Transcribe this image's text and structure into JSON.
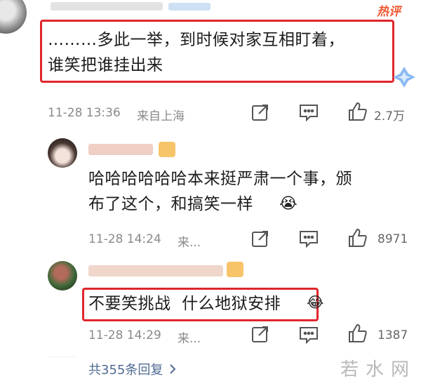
{
  "badge": {
    "hot_label": "热评"
  },
  "comment1": {
    "text_line1": "………多此一举，到时候对家互相盯着，",
    "text_line2": "谁笑把谁挂出来",
    "timestamp": "11-28 13:36",
    "location": "来自上海",
    "likes": "2.7万"
  },
  "reply1": {
    "text_line1": "哈哈哈哈哈哈本来挺严肃一个事，颁",
    "text_line2": "布了这个，和搞笑一样",
    "emoji": "😭",
    "timestamp": "11-28 14:24",
    "location": "来...",
    "likes": "8971"
  },
  "reply2": {
    "text": "不要笑挑战  什么地狱安排",
    "emoji": "😂",
    "timestamp": "11-28 14:29",
    "location": "来...",
    "likes": "1387"
  },
  "footer": {
    "more_replies": "共355条回复",
    "watermark": "若水网"
  },
  "colors": {
    "highlight": "#e0262b",
    "hot": "#f05a34",
    "link": "#4f6a93"
  },
  "icons": [
    "share-icon",
    "comment-icon",
    "like-icon",
    "chevron-right-icon",
    "sparkle-icon"
  ]
}
